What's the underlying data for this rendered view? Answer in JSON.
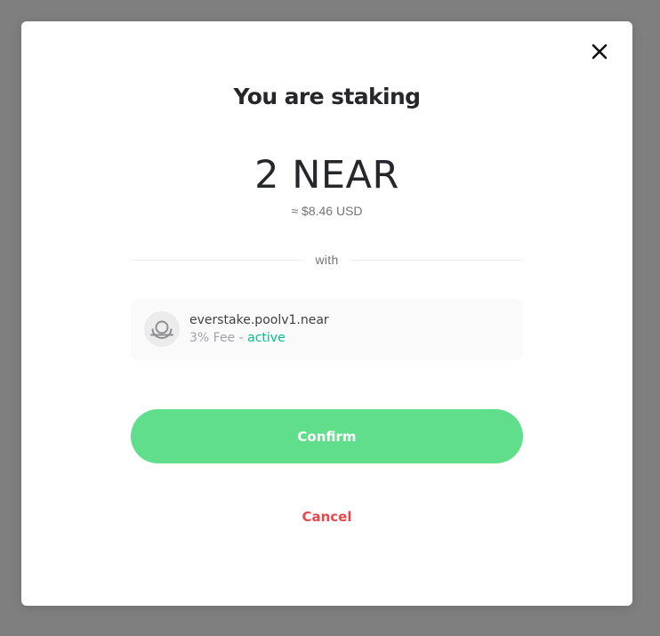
{
  "modal": {
    "title": "You are staking",
    "amount": "2 NEAR",
    "usd_value": "≈ $8.46 USD",
    "separator_text": "with",
    "validator": {
      "name": "everstake.poolv1.near",
      "fee": "3% Fee",
      "separator": " - ",
      "status": "active",
      "icon": "validator-pool-icon"
    },
    "confirm_label": "Confirm",
    "cancel_label": "Cancel",
    "close_icon": "close-icon"
  },
  "colors": {
    "overlay": "#7f7f7f",
    "confirm_button": "#61de8c",
    "cancel_text": "#e5484d",
    "status_active": "#00c08b"
  }
}
